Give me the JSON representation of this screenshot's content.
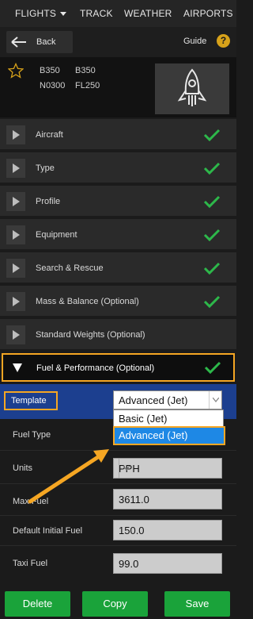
{
  "nav": {
    "flights": "FLIGHTS",
    "track": "TRACK",
    "weather": "WEATHER",
    "airports": "AIRPORTS"
  },
  "header": {
    "back_label": "Back",
    "guide_label": "Guide",
    "guide_icon": "?"
  },
  "flight": {
    "type_1": "B350",
    "type_2": "B350",
    "speed": "N0300",
    "level": "FL250"
  },
  "sections": [
    {
      "label": "Aircraft"
    },
    {
      "label": "Type"
    },
    {
      "label": "Profile"
    },
    {
      "label": "Equipment"
    },
    {
      "label": "Search & Rescue"
    },
    {
      "label": "Mass & Balance (Optional)"
    },
    {
      "label": "Standard Weights (Optional)"
    }
  ],
  "fuel_section": {
    "label": "Fuel & Performance (Optional)"
  },
  "template": {
    "label": "Template",
    "selected": "Advanced (Jet)",
    "options": [
      "Basic (Jet)",
      "Advanced (Jet)"
    ]
  },
  "fields": {
    "fuel_type": "Fuel Type",
    "units_label": "Units",
    "units_value": "PPH",
    "max_fuel_label": "Max Fuel",
    "max_fuel_value": "3611.0",
    "default_initial_fuel_label": "Default Initial Fuel",
    "default_initial_fuel_value": "150.0",
    "taxi_fuel_label": "Taxi Fuel",
    "taxi_fuel_value": "99.0"
  },
  "actions": {
    "delete": "Delete",
    "copy": "Copy",
    "save": "Save"
  },
  "colors": {
    "accent_orange": "#f5a623",
    "check_green": "#2db84a",
    "button_green": "#1aa33a",
    "template_blue": "#1c3f8f",
    "selected_option_blue": "#1e88e5",
    "star_gold": "#d7a21a"
  }
}
